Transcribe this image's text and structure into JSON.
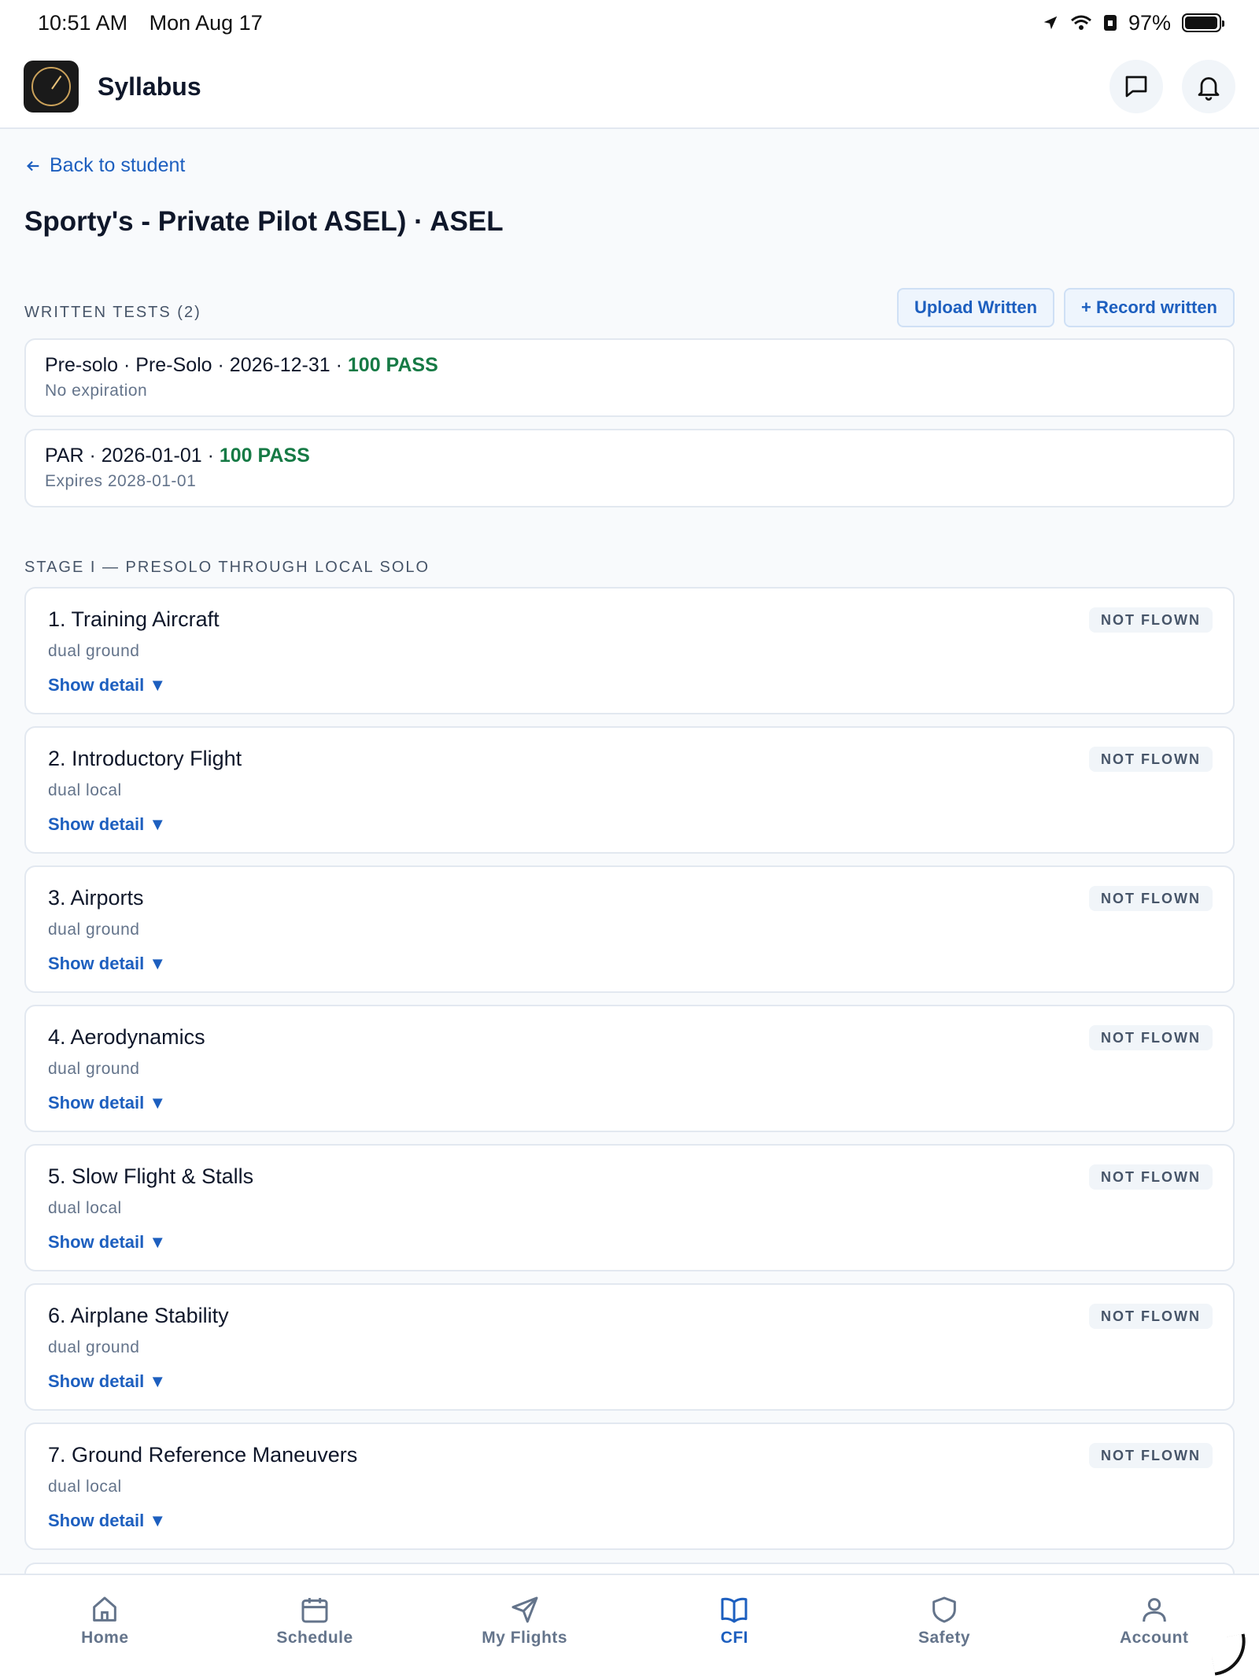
{
  "status": {
    "time": "10:51 AM",
    "date": "Mon Aug 17",
    "battery": "97%",
    "battery_level": 0.97
  },
  "header": {
    "title": "Syllabus"
  },
  "back_label": "Back to student",
  "page_title": "Sporty's - Private Pilot ASEL) · ASEL",
  "written": {
    "label": "WRITTEN TESTS (2)",
    "upload_label": "Upload Written",
    "record_label": "+ Record written",
    "tests": [
      {
        "summary": "Pre-solo · Pre-Solo · 2026-12-31 · ",
        "score": "100 PASS",
        "note": "No expiration"
      },
      {
        "summary": "PAR · 2026-01-01 · ",
        "score": "100 PASS",
        "note": "Expires 2028-01-01"
      }
    ]
  },
  "stage": {
    "label": "STAGE I — PRESOLO THROUGH LOCAL SOLO",
    "detail_label": "Show detail ▼",
    "lessons": [
      {
        "name": "1. Training Aircraft",
        "type": "dual ground",
        "status": "NOT FLOWN"
      },
      {
        "name": "2. Introductory Flight",
        "type": "dual local",
        "status": "NOT FLOWN"
      },
      {
        "name": "3. Airports",
        "type": "dual ground",
        "status": "NOT FLOWN"
      },
      {
        "name": "4. Aerodynamics",
        "type": "dual ground",
        "status": "NOT FLOWN"
      },
      {
        "name": "5. Slow Flight & Stalls",
        "type": "dual local",
        "status": "NOT FLOWN"
      },
      {
        "name": "6. Airplane Stability",
        "type": "dual ground",
        "status": "NOT FLOWN"
      },
      {
        "name": "7. Ground Reference Maneuvers",
        "type": "dual local",
        "status": "NOT FLOWN"
      }
    ]
  },
  "tabs": [
    {
      "label": "Home",
      "icon": "home-icon"
    },
    {
      "label": "Schedule",
      "icon": "calendar-icon"
    },
    {
      "label": "My Flights",
      "icon": "paper-plane-icon"
    },
    {
      "label": "CFI",
      "icon": "book-icon",
      "active": true
    },
    {
      "label": "Safety",
      "icon": "shield-icon"
    },
    {
      "label": "Account",
      "icon": "user-icon"
    }
  ],
  "colors": {
    "accent": "#1d5fbf",
    "pass": "#167a45",
    "muted": "#64748b"
  }
}
